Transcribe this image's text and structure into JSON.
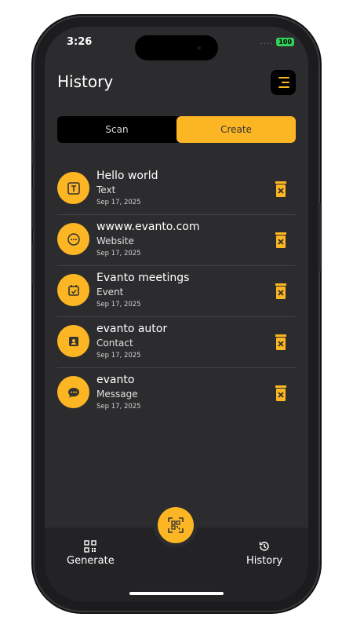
{
  "status_bar": {
    "time": "3:26",
    "signal": "....",
    "battery": "100"
  },
  "header": {
    "title": "History",
    "menu_icon": "menu-icon"
  },
  "tabs": [
    {
      "label": "Scan",
      "active": false
    },
    {
      "label": "Create",
      "active": true
    }
  ],
  "history": [
    {
      "title": "Hello world",
      "type": "Text",
      "date": "Sep 17, 2025",
      "icon": "text-icon"
    },
    {
      "title": "wwww.evanto.com",
      "type": "Website",
      "date": "Sep 17, 2025",
      "icon": "link-icon"
    },
    {
      "title": "Evanto meetings",
      "type": "Event",
      "date": "Sep 17, 2025",
      "icon": "calendar-icon"
    },
    {
      "title": "evanto autor",
      "type": "Contact",
      "date": "Sep 17, 2025",
      "icon": "contact-icon"
    },
    {
      "title": "evanto",
      "type": "Message",
      "date": "Sep 17, 2025",
      "icon": "message-icon"
    }
  ],
  "bottom_nav": {
    "left_label": "Generate",
    "left_icon": "qr-grid-icon",
    "center_icon": "qr-scan-icon",
    "right_label": "History",
    "right_icon": "history-clock-icon"
  },
  "colors": {
    "accent": "#FDB623",
    "background": "#2C2C2E",
    "bar": "#232325"
  }
}
